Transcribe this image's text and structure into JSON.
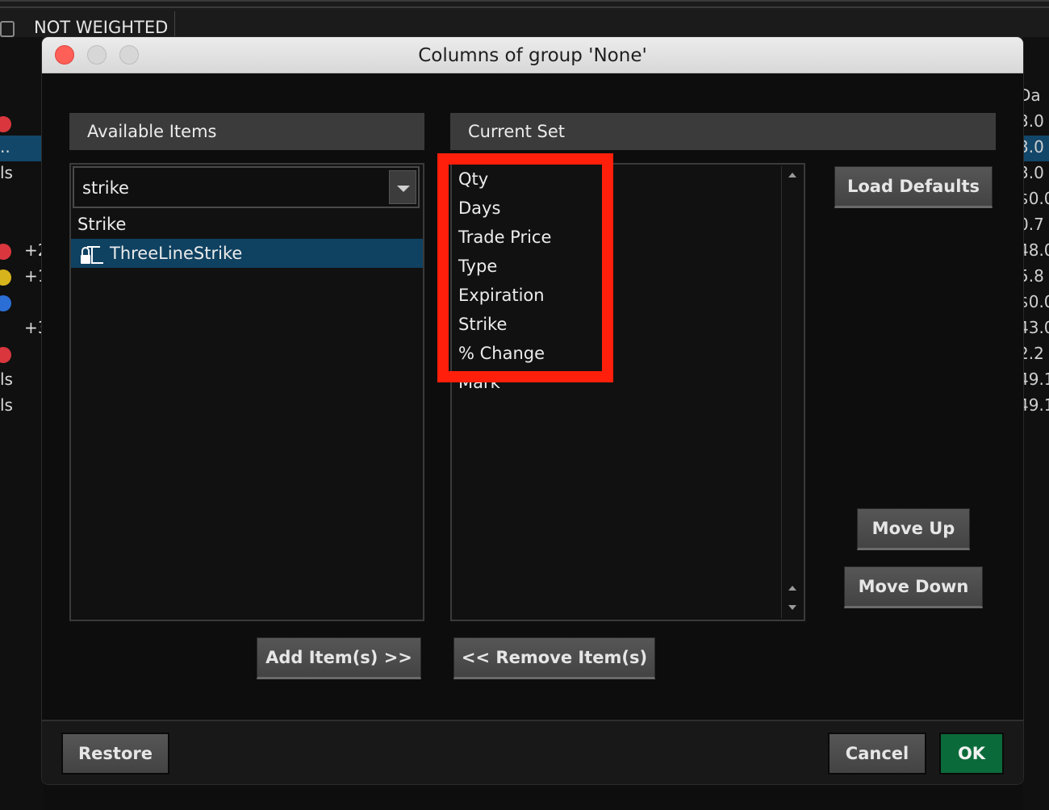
{
  "background": {
    "toolbar_label": "NOT WEIGHTED",
    "left_column": [
      {
        "text": "..",
        "selected": true
      },
      {
        "text": "ls"
      },
      {
        "text": "+2"
      },
      {
        "text": "+1"
      },
      {
        "text": "+3"
      },
      {
        "text": "ls"
      },
      {
        "text": "ls"
      }
    ],
    "right_column": [
      "Da",
      "3.0",
      "3.0",
      "3.0",
      "$0.0",
      "0.7",
      "48.0",
      "5.8",
      "$0.0",
      "43.0",
      "2.2",
      "49.1",
      "49.1"
    ]
  },
  "dialog": {
    "title": "Columns of group 'None'",
    "available": {
      "header": "Available Items",
      "search_value": "strike",
      "items": [
        {
          "label": "Strike",
          "selected": false
        },
        {
          "label": "ThreeLineStrike",
          "selected": true,
          "icon": "lock-icon"
        }
      ]
    },
    "current": {
      "header": "Current Set",
      "items": [
        "Qty",
        "Days",
        "Trade Price",
        "Type",
        "Expiration",
        "Strike",
        "% Change",
        "Mark"
      ]
    },
    "buttons": {
      "load_defaults": "Load Defaults",
      "move_up": "Move Up",
      "move_down": "Move Down",
      "add": "Add Item(s) >>",
      "remove": "<< Remove Item(s)",
      "restore": "Restore",
      "cancel": "Cancel",
      "ok": "OK"
    },
    "colors": {
      "highlight": "#ff1f0a",
      "selection": "#0f4161",
      "ok": "#0b6a3a"
    }
  }
}
